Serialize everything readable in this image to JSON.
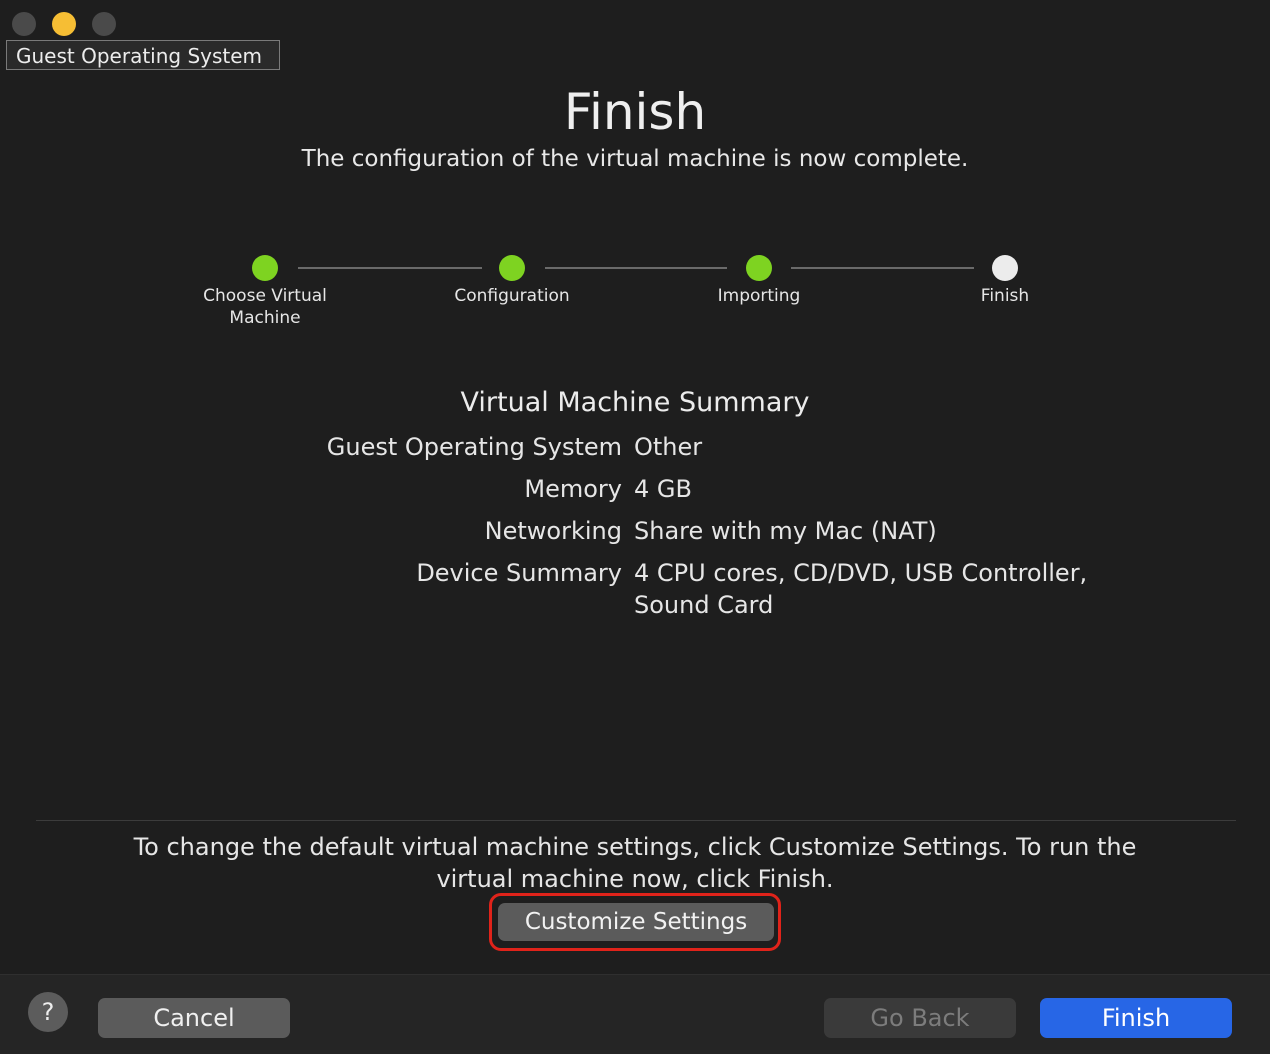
{
  "window": {
    "tooltip": "Guest Operating System"
  },
  "header": {
    "title": "Finish",
    "subtitle": "The configuration of the virtual machine is now complete."
  },
  "steps": [
    {
      "label": "Choose Virtual\nMachine",
      "state": "done"
    },
    {
      "label": "Configuration",
      "state": "done"
    },
    {
      "label": "Importing",
      "state": "done"
    },
    {
      "label": "Finish",
      "state": "current"
    }
  ],
  "summary": {
    "title": "Virtual Machine Summary",
    "rows": [
      {
        "key": "Guest Operating System",
        "value": "Other"
      },
      {
        "key": "Memory",
        "value": "4 GB"
      },
      {
        "key": "Networking",
        "value": "Share with my Mac (NAT)"
      },
      {
        "key": "Device Summary",
        "value": "4 CPU cores, CD/DVD, USB Controller, Sound Card"
      }
    ]
  },
  "hint": "To change the default virtual machine settings, click Customize Settings. To run the virtual machine now, click Finish.",
  "buttons": {
    "customize": "Customize Settings",
    "help": "?",
    "cancel": "Cancel",
    "go_back": "Go Back",
    "finish": "Finish"
  },
  "colors": {
    "step_done": "#7ed321",
    "step_current": "#ececec",
    "primary": "#2766e6",
    "highlight": "#e0231a"
  }
}
